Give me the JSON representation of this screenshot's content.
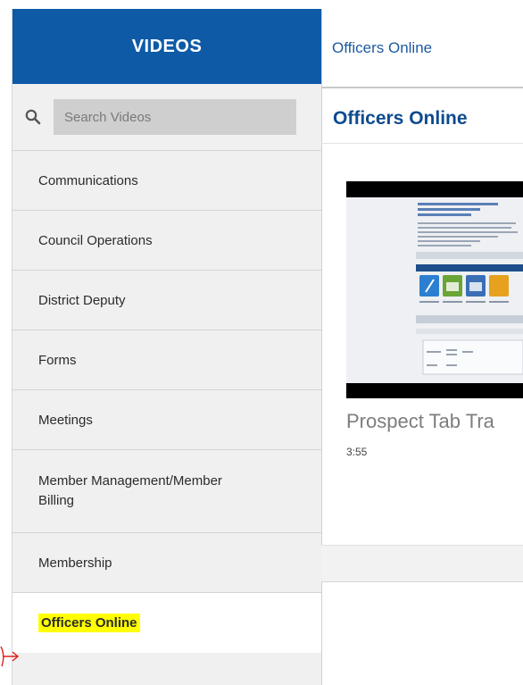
{
  "sidebar": {
    "header": "VIDEOS",
    "search_placeholder": "Search Videos",
    "items": [
      {
        "label": "Communications"
      },
      {
        "label": "Council Operations"
      },
      {
        "label": "District Deputy"
      },
      {
        "label": "Forms"
      },
      {
        "label": "Meetings"
      },
      {
        "label": "Member Management/Member Billing"
      },
      {
        "label": "Membership"
      },
      {
        "label": "Officers Online"
      }
    ]
  },
  "topbar": {
    "breadcrumb": "Officers Online"
  },
  "main": {
    "title": "Officers Online",
    "video": {
      "title": "Prospect Tab Tra",
      "duration": "3:55"
    }
  },
  "colors": {
    "header_bg": "#0e5aa7",
    "link": "#1e5aa0",
    "title": "#0e4b8f",
    "highlight": "#ffff00",
    "annotation": "#e0201c"
  },
  "icons": {
    "search": "search-icon",
    "annotation": "red-arrow-annotation"
  }
}
